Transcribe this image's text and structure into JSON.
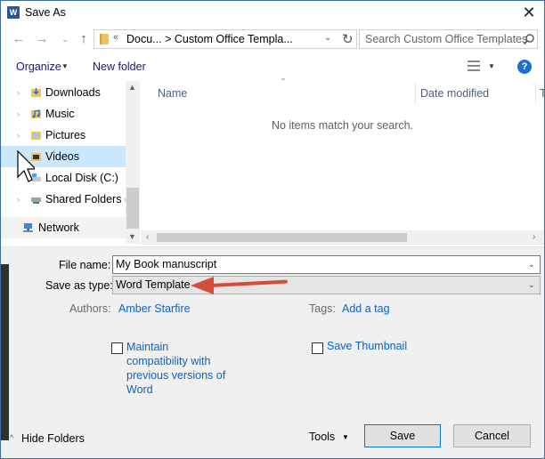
{
  "window": {
    "title": "Save As",
    "app_icon_letter": "W"
  },
  "address_bar": {
    "path_prefix": "«",
    "path_text": "Docu...  >  Custom Office Templa...",
    "search_placeholder": "Search Custom Office Templates"
  },
  "toolbar": {
    "organize_label": "Organize",
    "new_folder_label": "New folder"
  },
  "nav_pane": {
    "items": [
      {
        "label": "Downloads"
      },
      {
        "label": "Music"
      },
      {
        "label": "Pictures"
      },
      {
        "label": "Videos"
      },
      {
        "label": "Local Disk (C:)"
      },
      {
        "label": "Shared Folders (\\"
      },
      {
        "label": "Network"
      }
    ]
  },
  "file_list": {
    "columns": {
      "name": "Name",
      "date_modified": "Date modified",
      "type": "T"
    },
    "empty_message": "No items match your search."
  },
  "form": {
    "file_name_label": "File name:",
    "file_name_value": "My Book manuscript",
    "save_type_label": "Save as type:",
    "save_type_value": "Word Template",
    "authors_label": "Authors:",
    "authors_value": "Amber Starfire",
    "tags_label": "Tags:",
    "tags_value": "Add a tag",
    "maintain_compat_label": "Maintain compatibility with previous versions of Word",
    "maintain_compat_lines": [
      "Maintain",
      "compatibility with",
      "previous versions of",
      "Word"
    ],
    "save_thumbnail_label": "Save Thumbnail"
  },
  "footer": {
    "hide_folders_label": "Hide Folders",
    "tools_label": "Tools",
    "save_label": "Save",
    "cancel_label": "Cancel"
  },
  "colors": {
    "accent": "#0078d7",
    "link": "#0b63c4",
    "arrow": "#d64c3a",
    "selection": "#cce8ff"
  }
}
